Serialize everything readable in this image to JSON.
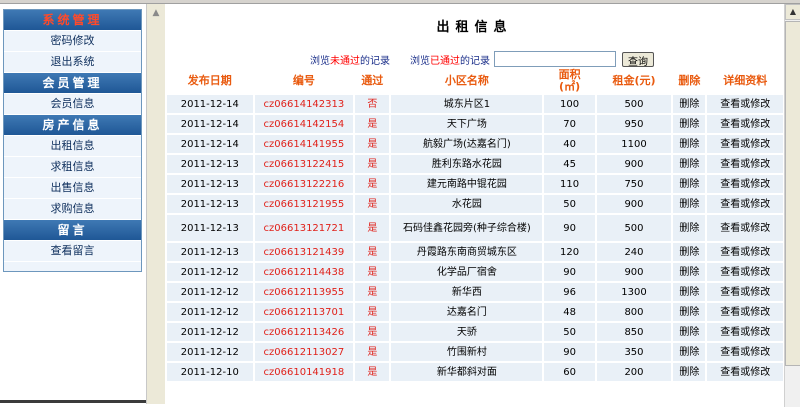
{
  "menu": [
    {
      "head": "系统管理",
      "head_red": true,
      "items": [
        "密码修改",
        "退出系统"
      ]
    },
    {
      "head": "会员管理",
      "head_red": false,
      "items": [
        "会员信息"
      ]
    },
    {
      "head": "房产信息",
      "head_red": false,
      "items": [
        "出租信息",
        "求租信息",
        "出售信息",
        "求购信息"
      ]
    },
    {
      "head": "留言",
      "head_red": false,
      "items": [
        "查看留言"
      ]
    }
  ],
  "main": {
    "title": "出租信息",
    "filter_unpassed_pre": "浏览",
    "filter_unpassed_mark": "未通过",
    "filter_unpassed_post": "的记录",
    "filter_passed_pre": "浏览",
    "filter_passed_mark": "已通过",
    "filter_passed_post": "的记录",
    "search_value": "",
    "search_button": "查询"
  },
  "table": {
    "headers": [
      "发布日期",
      "编号",
      "通过",
      "小区名称",
      "面积\n(㎡)",
      "租金(元)",
      "删除",
      "详细资料"
    ],
    "delete_label": "删除",
    "edit_label": "查看或修改",
    "rows": [
      {
        "date": "2011-12-14",
        "id": "cz06614142313",
        "passed": "否",
        "community": "城东片区1",
        "area": "100",
        "rent": "500"
      },
      {
        "date": "2011-12-14",
        "id": "cz06614142154",
        "passed": "是",
        "community": "天下广场",
        "area": "70",
        "rent": "950"
      },
      {
        "date": "2011-12-14",
        "id": "cz06614141955",
        "passed": "是",
        "community": "航毅广场(达嘉名门)",
        "area": "40",
        "rent": "1100"
      },
      {
        "date": "2011-12-13",
        "id": "cz06613122415",
        "passed": "是",
        "community": "胜利东路水花园",
        "area": "45",
        "rent": "900"
      },
      {
        "date": "2011-12-13",
        "id": "cz06613122216",
        "passed": "是",
        "community": "建元南路中锟花园",
        "area": "110",
        "rent": "750"
      },
      {
        "date": "2011-12-13",
        "id": "cz06613121955",
        "passed": "是",
        "community": "水花园",
        "area": "50",
        "rent": "900"
      },
      {
        "date": "2011-12-13",
        "id": "cz06613121721",
        "passed": "是",
        "community": "石码佳鑫花园旁(种子综合楼)",
        "area": "90",
        "rent": "500"
      },
      {
        "date": "2011-12-13",
        "id": "cz06613121439",
        "passed": "是",
        "community": "丹霞路东南商贸城东区",
        "area": "120",
        "rent": "240"
      },
      {
        "date": "2011-12-12",
        "id": "cz06612114438",
        "passed": "是",
        "community": "化学品厂宿舍",
        "area": "90",
        "rent": "900"
      },
      {
        "date": "2011-12-12",
        "id": "cz06612113955",
        "passed": "是",
        "community": "新华西",
        "area": "96",
        "rent": "1300"
      },
      {
        "date": "2011-12-12",
        "id": "cz06612113701",
        "passed": "是",
        "community": "达嘉名门",
        "area": "48",
        "rent": "800"
      },
      {
        "date": "2011-12-12",
        "id": "cz06612113426",
        "passed": "是",
        "community": "天骄",
        "area": "50",
        "rent": "850"
      },
      {
        "date": "2011-12-12",
        "id": "cz06612113027",
        "passed": "是",
        "community": "竹围新村",
        "area": "90",
        "rent": "350"
      },
      {
        "date": "2011-12-10",
        "id": "cz06610141918",
        "passed": "是",
        "community": "新华都斜对面",
        "area": "60",
        "rent": "200"
      }
    ]
  }
}
